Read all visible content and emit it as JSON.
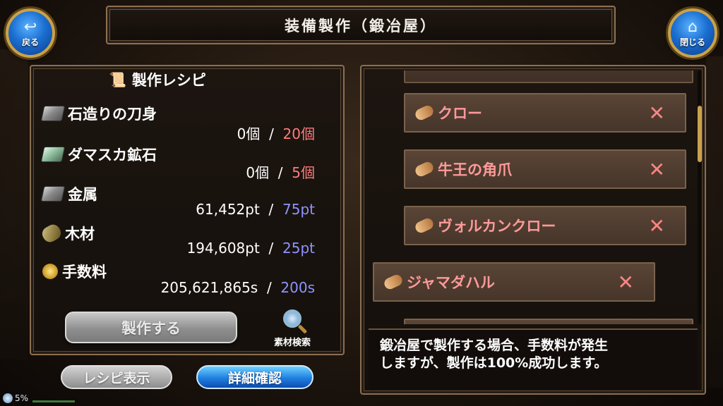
{
  "nav": {
    "back_label": "戻る",
    "close_label": "閉じる",
    "back_icon": "↩",
    "close_icon": "⌂"
  },
  "title": "装備製作（鍛冶屋）",
  "recipe": {
    "header": "製作レシピ",
    "materials": [
      {
        "name": "石造りの刀身",
        "have": "0個",
        "sep": "/",
        "need": "20個",
        "need_color": "red",
        "icon": "ingot-icon"
      },
      {
        "name": "ダマスカ鉱石",
        "have": "0個",
        "sep": "/",
        "need": "5個",
        "need_color": "red",
        "icon": "ore-icon"
      },
      {
        "name": "金属",
        "have": "61,452pt",
        "sep": "/",
        "need": "75pt",
        "need_color": "blue",
        "icon": "metal-icon"
      },
      {
        "name": "木材",
        "have": "194,608pt",
        "sep": "/",
        "need": "25pt",
        "need_color": "blue",
        "icon": "wood-icon"
      },
      {
        "name": "手数料",
        "have": "205,621,865s",
        "sep": "/",
        "need": "200s",
        "need_color": "blue",
        "icon": "coin-icon"
      }
    ],
    "craft_button": "製作する",
    "search_label": "素材検索"
  },
  "bottom_buttons": {
    "recipe_view": "レシピ表示",
    "detail_check": "詳細確認"
  },
  "item_list": [
    {
      "name": "クロー",
      "mark": "✕"
    },
    {
      "name": "牛王の角爪",
      "mark": "✕"
    },
    {
      "name": "ヴォルカンクロー",
      "mark": "✕"
    },
    {
      "name": "ジャマダハル",
      "mark": "✕"
    }
  ],
  "info": {
    "line1": "鍛冶屋で製作する場合、手数料が発生",
    "line2": "しますが、製作は100%成功します。"
  },
  "status": {
    "battery": "5%"
  },
  "colors": {
    "need_red": "#ff7b7b",
    "need_blue": "#8e93ff",
    "item_text": "#ff9a9a",
    "frame": "#8b6f51",
    "accent_gold": "#c9a24c"
  }
}
